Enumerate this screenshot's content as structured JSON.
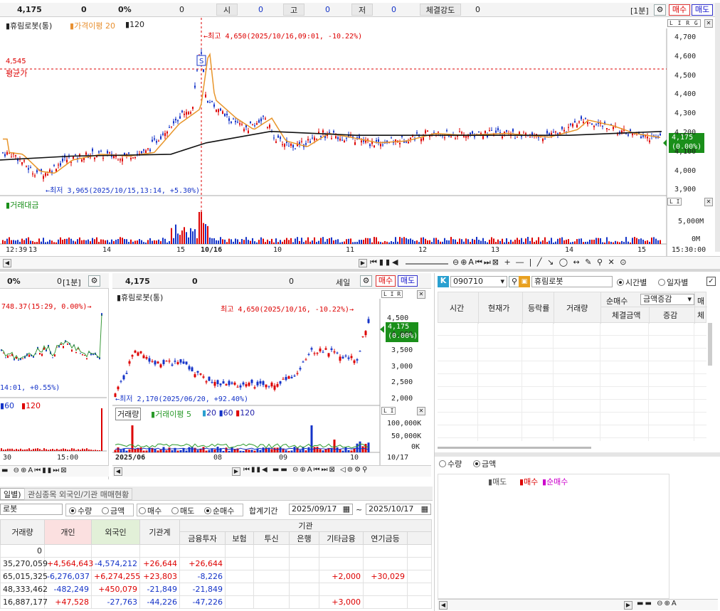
{
  "top": {
    "price": "4,175",
    "change": "0",
    "rate": "0%",
    "vol": "0",
    "open_lbl": "시",
    "open": "0",
    "high_lbl": "고",
    "high": "0",
    "low_lbl": "저",
    "low": "0",
    "strength_lbl": "체결강도",
    "strength": "0",
    "period": "[1분]",
    "buy": "매수",
    "sell": "매도"
  },
  "main": {
    "title": "휴림로봇(통)",
    "ma_label": "가격이평 20",
    "ma120": "120",
    "max_note": "←최고 4,650(2025/10/16,09:01, -10.22%)",
    "min_note": "←최저 3,965(2025/10/15,13:14, +5.30%)",
    "avg_val": "4,545",
    "avg_lbl": "평균가",
    "axis": [
      "4,700",
      "4,600",
      "4,500",
      "4,400",
      "4,300",
      "4,200",
      "4,100",
      "4,000",
      "3,900"
    ],
    "cur_price": "4,175",
    "cur_rate": "(0.00%)",
    "vol_title": "거래대금",
    "vol_axis": [
      "5,000M",
      "0M"
    ],
    "xlabels": [
      "12:39",
      "13",
      "14",
      "15",
      "10/16",
      "10",
      "11",
      "12",
      "13",
      "14",
      "15"
    ],
    "time": "15:30:00",
    "scale_icons": "L I R G"
  },
  "left": {
    "rate": "0%",
    "val": "0",
    "period": "[1분]",
    "note1": "748.37(15:29, 0.00%)→",
    "note2": "14:01, +0.55%)",
    "legend": [
      "60",
      "120"
    ],
    "xlabels": [
      "30",
      "15:00"
    ]
  },
  "mid": {
    "price": "4,175",
    "change": "0",
    "vol": "0",
    "period": "세일",
    "buy": "매수",
    "sell": "매도",
    "title": "휴림로봇(통)",
    "max_note": "최고 4,650(2025/10/16, -10.22%)→",
    "min_note": "←최저 2,170(2025/06/20, +92.40%)",
    "axis": [
      "4,500",
      "4,000",
      "3,500",
      "3,000",
      "2,500",
      "2,000"
    ],
    "cur_price": "4,175",
    "cur_rate": "(0.00%)",
    "vol_title": "거래량",
    "vol_ma": "거래이평 5",
    "vol_legend": [
      "20",
      "60",
      "120"
    ],
    "vol_axis": [
      "100,000K",
      "50,000K",
      "0K"
    ],
    "xlabels": [
      "2025/06",
      "08",
      "09",
      "10",
      "10/17"
    ]
  },
  "right": {
    "code": "090710",
    "name": "휴림로봇",
    "opt_time": "시간별",
    "opt_day": "일자별",
    "cols": [
      "시간",
      "현재가",
      "등락률",
      "거래량"
    ],
    "net_buy": "순매수",
    "amount_change": "금액증감",
    "sub_cols": [
      "체결금액",
      "증감"
    ],
    "extra": "매",
    "extra2": "체",
    "qty": "수량",
    "amt": "금액",
    "legend_sell": "매도",
    "legend_buy": "매수",
    "legend_net": "순매수"
  },
  "bottom": {
    "tabs": [
      "일별)",
      "관심종목 외국인/기관 매매현황"
    ],
    "stock": "로봇",
    "opts": [
      "수량",
      "금액",
      "매수",
      "매도",
      "순매수"
    ],
    "period_lbl": "합계기간",
    "from": "2025/09/17",
    "to": "2025/10/17",
    "head": [
      "거래량",
      "개인",
      "외국인",
      "기관계",
      "기관"
    ],
    "inst_cols": [
      "금융투자",
      "보험",
      "투신",
      "은행",
      "기타금융",
      "연기금등"
    ],
    "rows": [
      [
        "0",
        "",
        "",
        "",
        "",
        "",
        "",
        "",
        "",
        ""
      ],
      [
        "35,270,059",
        "+4,564,643",
        "-4,574,212",
        "+26,644",
        "+26,644",
        "",
        "",
        "",
        "",
        ""
      ],
      [
        "65,015,325",
        "-6,276,037",
        "+6,274,255",
        "+23,803",
        "-8,226",
        "",
        "",
        "",
        "+2,000",
        "+30,029"
      ],
      [
        "48,333,462",
        "-482,249",
        "+450,079",
        "-21,849",
        "-21,849",
        "",
        "",
        "",
        "",
        ""
      ],
      [
        "16,887,177",
        "+47,528",
        "-27,763",
        "-44,226",
        "-47,226",
        "",
        "",
        "",
        "+3,000",
        ""
      ]
    ]
  }
}
